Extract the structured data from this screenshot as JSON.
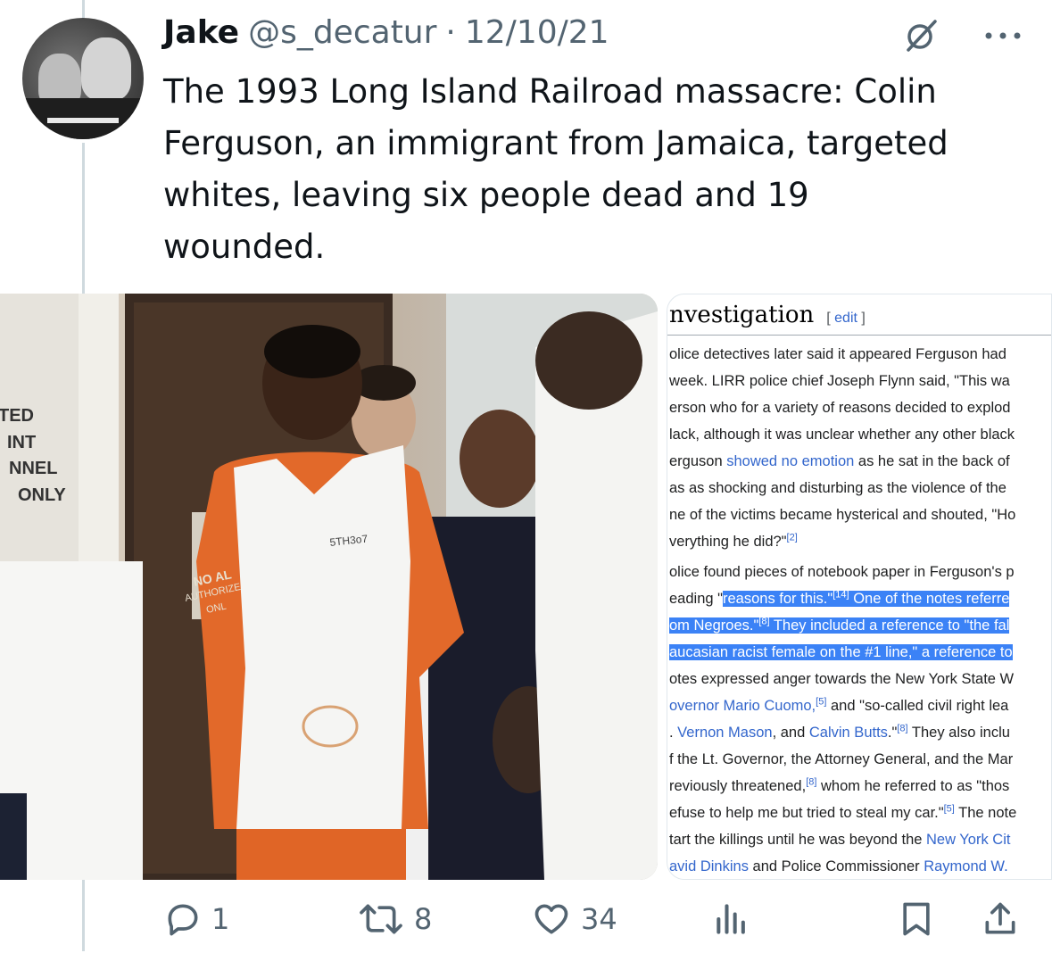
{
  "tweet": {
    "author_name": "Jake",
    "author_handle": "@s_decatur",
    "separator": "·",
    "date": "12/10/21",
    "text": "The 1993 Long Island Railroad massacre: Colin\nFerguson, an immigrant from Jamaica, targeted\nwhites, leaving six people dead and 19\nwounded."
  },
  "photo": {
    "sign_lines": [
      "TED",
      "INT",
      "NNEL",
      "ONLY"
    ],
    "door_sign_lines": [
      "NO AL",
      "AUTHORIZE",
      "ONL"
    ],
    "vest_tag": "5TH3o7"
  },
  "wiki": {
    "heading": "nvestigation",
    "edit_open": "[",
    "edit_label": "edit",
    "edit_close": "]",
    "p1": {
      "l1": "olice detectives later said it appeared Ferguson had",
      "l2": "week. LIRR police chief Joseph Flynn said, \"This wa",
      "l3": "erson who for a variety of reasons decided to explod",
      "l4": "lack, although it was unclear whether any other black",
      "l5_a": "erguson ",
      "l5_link": "showed no emotion",
      "l5_b": " as he sat in the back of",
      "l6": "as as shocking and disturbing as the violence of the",
      "l7": "ne of the victims became hysterical and shouted, \"Ho",
      "l8_a": "verything he did?\"",
      "l8_sup": "[2]"
    },
    "p2": {
      "l1": "olice found pieces of notebook paper in Ferguson's p",
      "l2_a": "eading \"",
      "l2_hl_a": "reasons for this.\"",
      "l2_sup": "[14]",
      "l2_hl_b": " One of the notes referre",
      "l3_hl_a": "om Negroes.\"",
      "l3_sup": "[8]",
      "l3_hl_b": " They included a reference to \"the fal",
      "l4_hl": "aucasian racist female on the #1 line,\" a reference to",
      "l5": "otes expressed anger towards the New York State W",
      "l6_link": "overnor Mario Cuomo,",
      "l6_sup": "[5]",
      "l6_b": " and \"so-called civil right lea",
      "l7_a": ". ",
      "l7_link1": "Vernon Mason",
      "l7_b": ", and ",
      "l7_link2": "Calvin Butts",
      "l7_c": ".\"",
      "l7_sup": "[8]",
      "l7_d": " They also inclu",
      "l8": "f the Lt. Governor, the Attorney General, and the Mar",
      "l9_a": "reviously threatened,",
      "l9_sup": "[8]",
      "l9_b": " whom he referred to as \"thos",
      "l10_a": "efuse to help me but tried to steal my car.\"",
      "l10_sup": "[5]",
      "l10_b": " The note",
      "l11_a": "tart the killings until he was beyond the ",
      "l11_link": "New York Cit",
      "l12_link1": "avid Dinkins",
      "l12_b": " and Police Commissioner ",
      "l12_link2": "Raymond W."
    }
  },
  "actions": {
    "reply_count": "1",
    "retweet_count": "8",
    "like_count": "34"
  },
  "icons": [
    "grok-icon",
    "more-icon",
    "reply-icon",
    "retweet-icon",
    "like-icon",
    "views-icon",
    "bookmark-icon",
    "share-icon"
  ],
  "colors": {
    "text": "#0f1419",
    "secondary": "#536471",
    "wiki_link": "#3366cc",
    "highlight": "#3b82f6"
  }
}
